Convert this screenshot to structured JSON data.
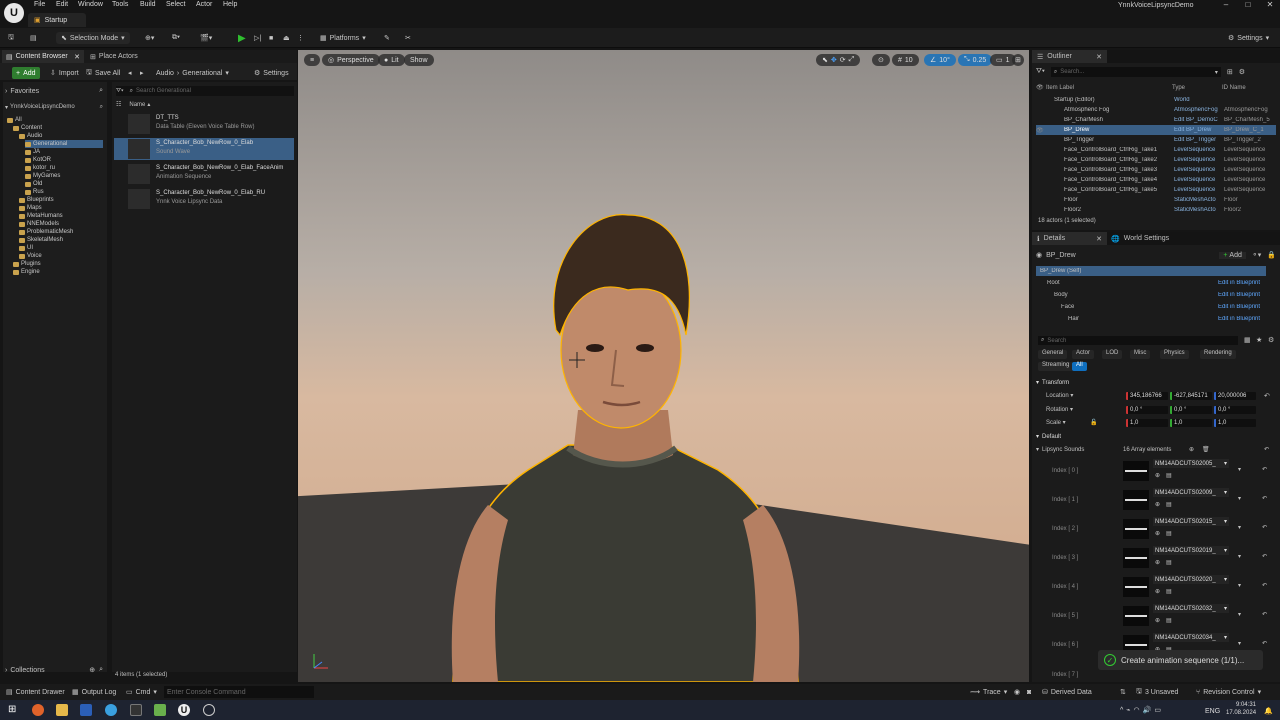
{
  "titlebar": {
    "menu": [
      "File",
      "Edit",
      "Window",
      "Tools",
      "Build",
      "Select",
      "Actor",
      "Help"
    ],
    "level_tab": "Startup",
    "project_name": "YnnkVoiceLipsyncDemo"
  },
  "toolbar": {
    "selection_mode": "Selection Mode",
    "platforms": "Platforms",
    "settings": "Settings"
  },
  "content_browser": {
    "tab_label": "Content Browser",
    "place_actors_label": "Place Actors",
    "add_label": "Add",
    "import_label": "Import",
    "save_all_label": "Save All",
    "path": [
      "Audio",
      "Generational"
    ],
    "settings_label": "Settings",
    "favorites_label": "Favorites",
    "project_root": "YnnkVoiceLipsyncDemo",
    "search_placeholder": "Search Generational",
    "name_column": "Name",
    "tree": [
      {
        "label": "All",
        "depth": 0
      },
      {
        "label": "Content",
        "depth": 1
      },
      {
        "label": "Audio",
        "depth": 2
      },
      {
        "label": "Generational",
        "depth": 3,
        "selected": true
      },
      {
        "label": "JA",
        "depth": 3
      },
      {
        "label": "KotOR",
        "depth": 3
      },
      {
        "label": "kotor_ru",
        "depth": 3
      },
      {
        "label": "MyGames",
        "depth": 3
      },
      {
        "label": "Old",
        "depth": 3
      },
      {
        "label": "Rus",
        "depth": 3
      },
      {
        "label": "Blueprints",
        "depth": 2
      },
      {
        "label": "Maps",
        "depth": 2
      },
      {
        "label": "MetaHumans",
        "depth": 2
      },
      {
        "label": "NNEModels",
        "depth": 2
      },
      {
        "label": "ProblematicMesh",
        "depth": 2
      },
      {
        "label": "SkeletalMesh",
        "depth": 2
      },
      {
        "label": "UI",
        "depth": 2
      },
      {
        "label": "Voice",
        "depth": 2
      },
      {
        "label": "Plugins",
        "depth": 1
      },
      {
        "label": "Engine",
        "depth": 1
      }
    ],
    "assets": [
      {
        "name": "DT_TTS",
        "type": "Data Table (Eleven Voice Table Row)"
      },
      {
        "name": "S_Character_Bob_NewRow_0_Elab",
        "type": "Sound Wave",
        "selected": true
      },
      {
        "name": "S_Character_Bob_NewRow_0_Elab_FaceAnim",
        "type": "Animation Sequence"
      },
      {
        "name": "S_Character_Bob_NewRow_0_Elab_RU",
        "type": "Ynnk Voice Lipsync Data"
      }
    ],
    "collections_label": "Collections",
    "items_status": "4 items (1 selected)"
  },
  "viewport": {
    "perspective": "Perspective",
    "lit": "Lit",
    "show": "Show",
    "grid_snap": "10",
    "rot_snap": "10°",
    "scale_snap": "0.25",
    "cam_speed": "1"
  },
  "outliner": {
    "tab_label": "Outliner",
    "search_placeholder": "Search...",
    "col_label": "Item Label",
    "col_type": "Type",
    "col_id": "ID Name",
    "rows": [
      {
        "label": "Startup (Editor)",
        "type": "World",
        "id": "",
        "depth": 0
      },
      {
        "label": "Atmospheric Fog",
        "type": "AtmosphericFog",
        "id": "AtmosphericFog",
        "depth": 1
      },
      {
        "label": "BP_CharMesh",
        "type": "Edit BP_DemoC",
        "id": "BP_CharMesh_5",
        "depth": 1
      },
      {
        "label": "BP_Drew",
        "type": "Edit BP_Drew",
        "id": "BP_Drew_C_1",
        "depth": 1,
        "selected": true
      },
      {
        "label": "BP_Trigger",
        "type": "Edit BP_Trigger",
        "id": "BP_Trigger_2",
        "depth": 1
      },
      {
        "label": "Face_ControlBoard_CtrlRig_Take1",
        "type": "LevelSequence",
        "id": "LevelSequence",
        "depth": 1
      },
      {
        "label": "Face_ControlBoard_CtrlRig_Take2",
        "type": "LevelSequence",
        "id": "LevelSequence",
        "depth": 1
      },
      {
        "label": "Face_ControlBoard_CtrlRig_Take3",
        "type": "LevelSequence",
        "id": "LevelSequence",
        "depth": 1
      },
      {
        "label": "Face_ControlBoard_CtrlRig_Take4",
        "type": "LevelSequence",
        "id": "LevelSequence",
        "depth": 1
      },
      {
        "label": "Face_ControlBoard_CtrlRig_Take5",
        "type": "LevelSequence",
        "id": "LevelSequence",
        "depth": 1
      },
      {
        "label": "Floor",
        "type": "StaticMeshActo",
        "id": "Floor",
        "depth": 1
      },
      {
        "label": "Floor2",
        "type": "StaticMeshActo",
        "id": "Floor2",
        "depth": 1
      }
    ],
    "status": "18 actors (1 selected)"
  },
  "details": {
    "tab_label": "Details",
    "world_settings_label": "World Settings",
    "actor_name": "BP_Drew",
    "add_label": "Add",
    "components": [
      {
        "label": "BP_Drew (Self)",
        "depth": 0,
        "selected": true,
        "edit": ""
      },
      {
        "label": "Root",
        "depth": 1,
        "edit": "Edit in Blueprint"
      },
      {
        "label": "Body",
        "depth": 2,
        "edit": "Edit in Blueprint"
      },
      {
        "label": "Face",
        "depth": 3,
        "edit": "Edit in Blueprint"
      },
      {
        "label": "Hair",
        "depth": 4,
        "edit": "Edit in Blueprint"
      }
    ],
    "search_placeholder": "Search",
    "filters": [
      "General",
      "Actor",
      "LOD",
      "Misc",
      "Physics",
      "Rendering",
      "Streaming",
      "All"
    ],
    "active_filter": "All",
    "transform_label": "Transform",
    "location_label": "Location",
    "rotation_label": "Rotation",
    "scale_label": "Scale",
    "location": [
      "345,186766",
      "-627,845171",
      "20,000006"
    ],
    "rotation": [
      "0,0 °",
      "0,0 °",
      "0,0 °"
    ],
    "scale": [
      "1,0",
      "1,0",
      "1,0"
    ],
    "default_label": "Default",
    "lipsync_label": "Lipsync Sounds",
    "array_count": "16 Array elements",
    "lipsync_items": [
      {
        "index": "Index [ 0 ]",
        "asset": "NM14ADCUTS02005_"
      },
      {
        "index": "Index [ 1 ]",
        "asset": "NM14ADCUTS02009_"
      },
      {
        "index": "Index [ 2 ]",
        "asset": "NM14ADCUTS02015_"
      },
      {
        "index": "Index [ 3 ]",
        "asset": "NM14ADCUTS02019_"
      },
      {
        "index": "Index [ 4 ]",
        "asset": "NM14ADCUTS02020_"
      },
      {
        "index": "Index [ 5 ]",
        "asset": "NM14ADCUTS02032_"
      },
      {
        "index": "Index [ 6 ]",
        "asset": "NM14ADCUTS02034_"
      }
    ],
    "partial_index": "Index [ 7 ]"
  },
  "toast": {
    "text": "Create animation sequence (1/1)..."
  },
  "statusbar": {
    "content_drawer": "Content Drawer",
    "output_log": "Output Log",
    "cmd": "Cmd",
    "console_placeholder": "Enter Console Command",
    "trace": "Trace",
    "derived_data": "Derived Data",
    "unsaved": "3 Unsaved",
    "revision_control": "Revision Control"
  },
  "taskbar": {
    "lang": "ENG",
    "time": "9:04:31",
    "date": "17.08.2024"
  },
  "colors": {
    "accent_blue": "#0f6fbf",
    "selection_blue": "#3a5f86",
    "play_green": "#2fbf2f",
    "folder_yellow": "#c9a24d",
    "outline_yellow": "#ffb400"
  }
}
